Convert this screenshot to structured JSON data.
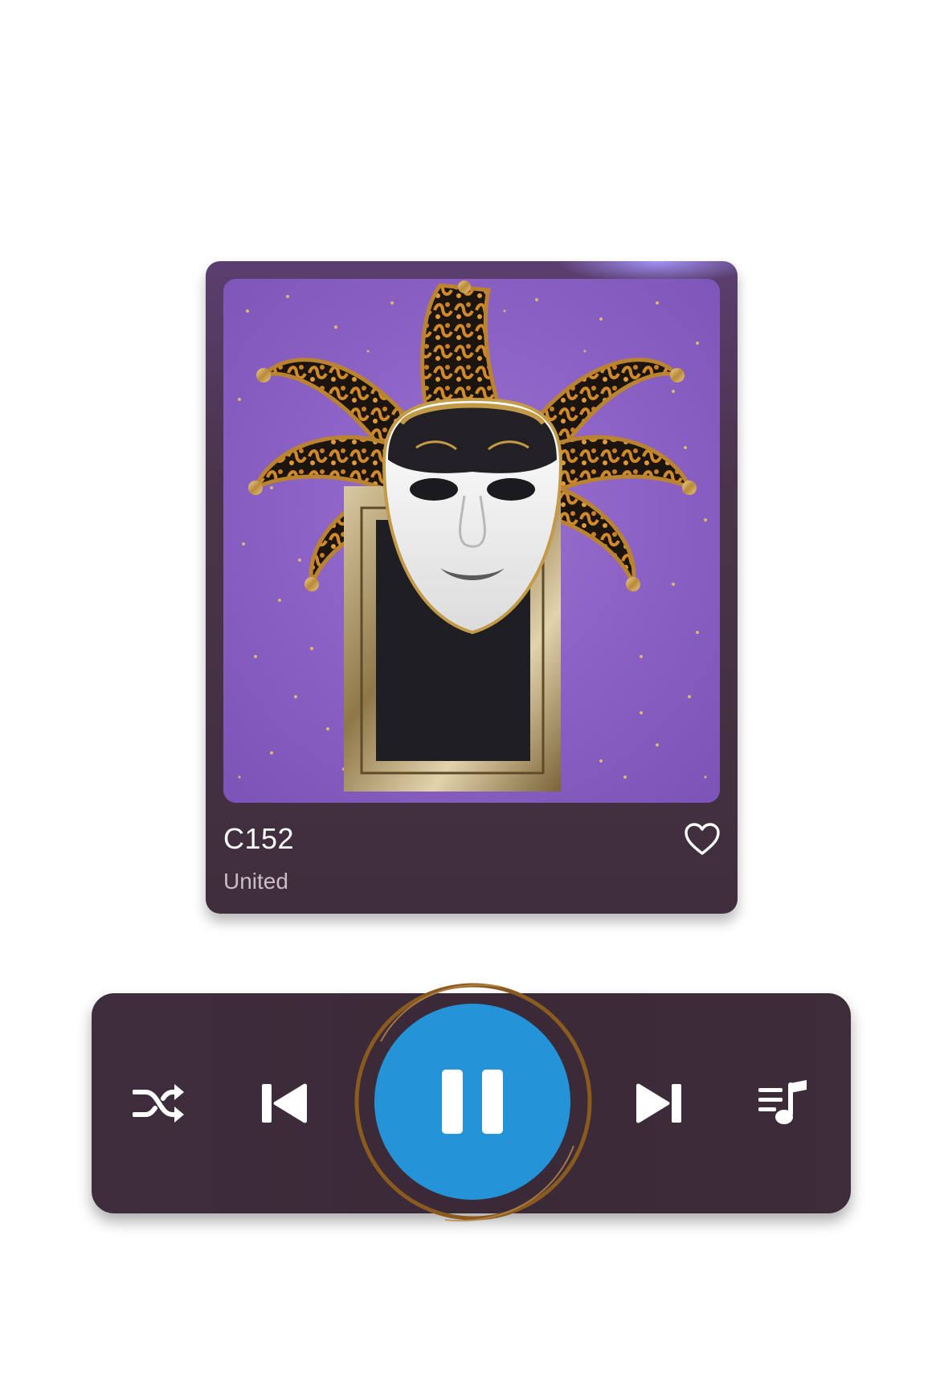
{
  "track": {
    "title": "C152",
    "artist": "United",
    "liked": false
  },
  "colors": {
    "card_top": "#5b3e70",
    "card_bottom": "#3f2e3d",
    "controls_bg": "#3b2b39",
    "play_button": "#2593d8",
    "ring": "#8a5a1e",
    "artwork_bg": "#8d62c4"
  },
  "icons": {
    "like": "heart-outline-icon",
    "shuffle": "shuffle-icon",
    "previous": "skip-previous-icon",
    "play_state": "pause-icon",
    "next": "skip-next-icon",
    "queue": "queue-music-icon"
  },
  "artwork": {
    "description_icon": "jester-mask-artwork"
  }
}
